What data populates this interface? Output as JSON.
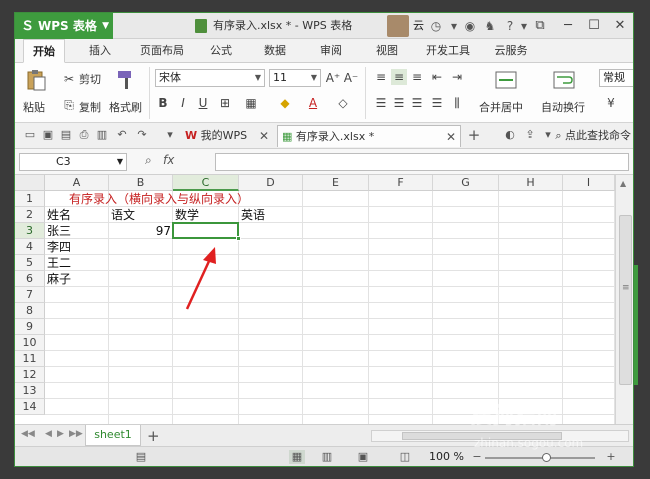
{
  "app": {
    "name": "WPS 表格",
    "document_title": "有序录入.xlsx * - WPS 表格",
    "user_label": "云"
  },
  "ribbon_tabs": [
    "开始",
    "插入",
    "页面布局",
    "公式",
    "数据",
    "审阅",
    "视图",
    "开发工具",
    "云服务"
  ],
  "ribbon": {
    "paste": "粘贴",
    "cut": "剪切",
    "copy": "复制",
    "format_painter": "格式刷",
    "font_name": "宋体",
    "font_size": "11",
    "bold": "B",
    "italic": "I",
    "underline": "U",
    "merge_center": "合并居中",
    "wrap_text": "自动换行",
    "number_format": "常规"
  },
  "doc_tabs": {
    "home": "我的WPS",
    "active": "有序录入.xlsx *",
    "search_commands": "点此查找命令"
  },
  "formula_bar": {
    "name_box": "C3",
    "fx": "fx",
    "content": ""
  },
  "columns": [
    "A",
    "B",
    "C",
    "D",
    "E",
    "F",
    "G",
    "H",
    "I"
  ],
  "rows": [
    "1",
    "2",
    "3",
    "4",
    "5",
    "6",
    "7",
    "8",
    "9",
    "10",
    "11",
    "12",
    "13",
    "14"
  ],
  "cells": {
    "A1": "有序录入（横向录入与纵向录入）",
    "A2": "姓名",
    "B2": "语文",
    "C2": "数学",
    "D2": "英语",
    "A3": "张三",
    "B3": "97",
    "A4": "李四",
    "A5": "王二",
    "A6": "麻子"
  },
  "sheet": {
    "tab": "sheet1",
    "add": "+"
  },
  "status": {
    "zoom": "100 %",
    "zoom_fraction": 0.55
  },
  "watermark": {
    "brand": "搜狗指南",
    "url": "zhinan.sogou.com"
  },
  "colors": {
    "accent": "#3e9b3e",
    "red_text": "#c62020",
    "arrow": "#e02020"
  }
}
